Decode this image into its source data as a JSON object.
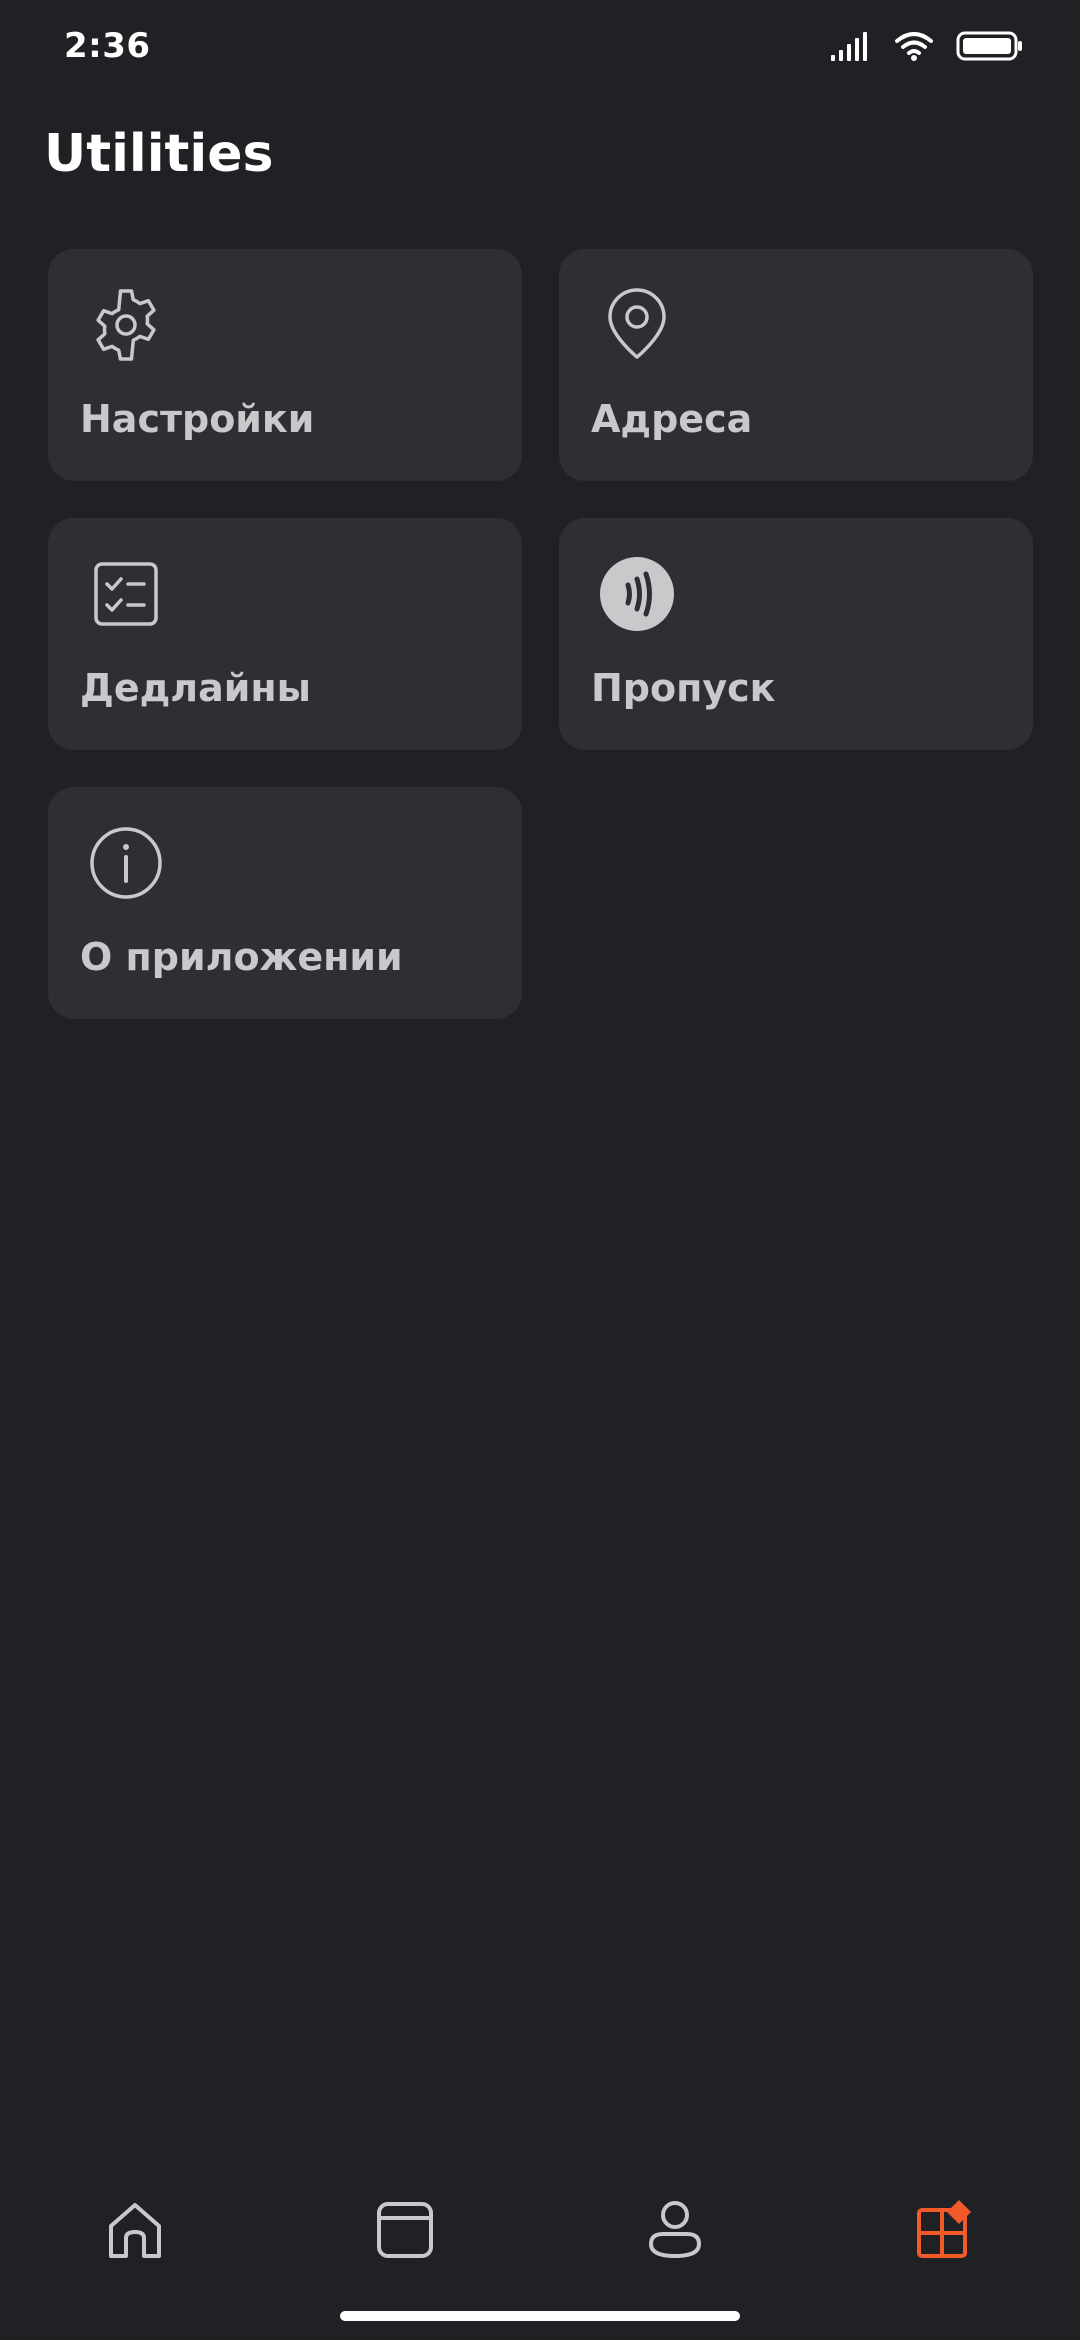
{
  "status_bar": {
    "time": "2:36",
    "icons": [
      "signal-icon",
      "wifi-icon",
      "battery-icon"
    ]
  },
  "page": {
    "title": "Utilities"
  },
  "tiles": [
    {
      "label": "Настройки",
      "icon": "gear-icon"
    },
    {
      "label": "Адреса",
      "icon": "location-pin-icon"
    },
    {
      "label": "Дедлайны",
      "icon": "checklist-icon"
    },
    {
      "label": "Пропуск",
      "icon": "contactless-icon"
    },
    {
      "label": "О приложении",
      "icon": "info-icon"
    }
  ],
  "bottom_nav": {
    "items": [
      {
        "name": "home",
        "icon": "home-icon",
        "active": false
      },
      {
        "name": "calendar",
        "icon": "calendar-icon",
        "active": false
      },
      {
        "name": "profile",
        "icon": "profile-icon",
        "active": false
      },
      {
        "name": "utilities",
        "icon": "utilities-grid-icon",
        "active": true
      }
    ]
  },
  "colors": {
    "background": "#202125",
    "tile": "#2e2f34",
    "icon": "#c9c9cb",
    "accent": "#f25a2a"
  }
}
